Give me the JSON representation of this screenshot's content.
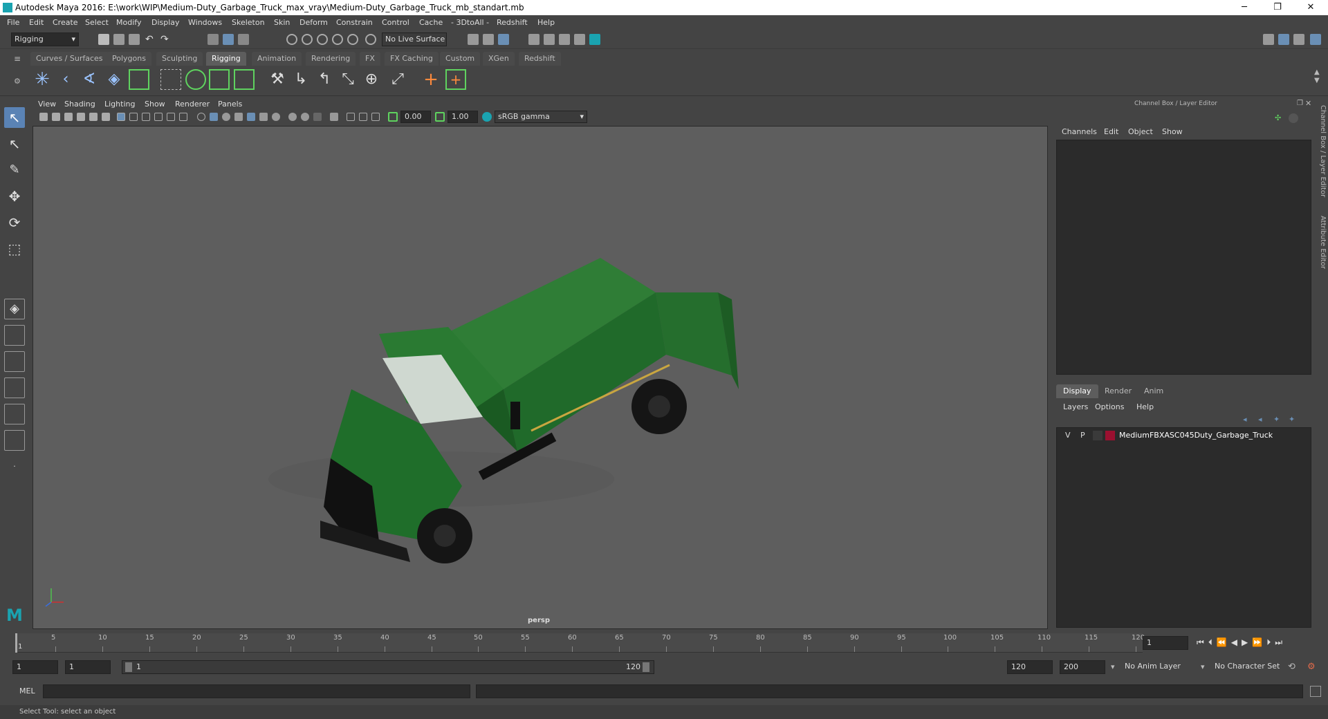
{
  "window": {
    "title": "Autodesk Maya 2016: E:\\work\\WIP\\Medium-Duty_Garbage_Truck_max_vray\\Medium-Duty_Garbage_Truck_mb_standart.mb",
    "minimize": "─",
    "restore": "❐",
    "close": "✕"
  },
  "menubar": [
    "File",
    "Edit",
    "Create",
    "Select",
    "Modify",
    "Display",
    "Windows",
    "Skeleton",
    "Skin",
    "Deform",
    "Constrain",
    "Control",
    "Cache",
    "- 3DtoAll -",
    "Redshift",
    "Help"
  ],
  "statusline": {
    "mode": "Rigging",
    "live_surface": "No Live Surface"
  },
  "shelf_tabs": [
    "Curves / Surfaces",
    "Polygons",
    "Sculpting",
    "Rigging",
    "Animation",
    "Rendering",
    "FX",
    "FX Caching",
    "Custom",
    "XGen",
    "Redshift"
  ],
  "shelf_active": "Rigging",
  "viewport": {
    "menus": [
      "View",
      "Shading",
      "Lighting",
      "Show",
      "Renderer",
      "Panels"
    ],
    "gamma_value": "0.00",
    "exposure_value": "1.00",
    "color_space": "sRGB gamma",
    "camera": "persp"
  },
  "right_panel": {
    "title": "Channel Box / Layer Editor",
    "channel_menus": [
      "Channels",
      "Edit",
      "Object",
      "Show"
    ],
    "tabs": [
      "Display",
      "Render",
      "Anim"
    ],
    "layer_menus": [
      "Layers",
      "Options",
      "Help"
    ],
    "layer": {
      "v": "V",
      "p": "P",
      "name": "MediumFBXASC045Duty_Garbage_Truck",
      "color": "#9b1030"
    }
  },
  "side_tabs": [
    "Channel Box / Layer Editor",
    "Attribute Editor"
  ],
  "timeline": {
    "ticks": [
      "5",
      "10",
      "15",
      "20",
      "25",
      "30",
      "35",
      "40",
      "45",
      "50",
      "55",
      "60",
      "65",
      "70",
      "75",
      "80",
      "85",
      "90",
      "95",
      "100",
      "105",
      "110",
      "115",
      "120"
    ],
    "start_marker": "1",
    "current_frame": "1"
  },
  "range": {
    "start": "1",
    "anim_start": "1",
    "slider_start": "1",
    "slider_end": "120",
    "anim_end": "120",
    "end": "200",
    "anim_layer": "No Anim Layer",
    "char_set": "No Character Set"
  },
  "cmdline": {
    "label": "MEL"
  },
  "helpline": {
    "text": "Select Tool: select an object"
  },
  "colors": {
    "accent_green": "#5fd35f",
    "truck_green": "#1f6e2a",
    "layer_red": "#9b1030"
  }
}
